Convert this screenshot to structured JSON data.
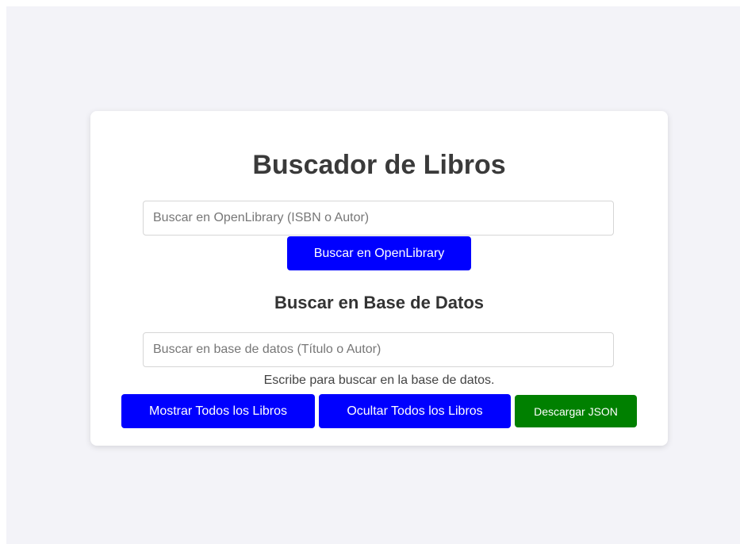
{
  "main": {
    "title": "Buscador de Libros",
    "openlibrary_search": {
      "placeholder": "Buscar en OpenLibrary (ISBN o Autor)",
      "value": "",
      "button_label": "Buscar en OpenLibrary"
    },
    "database_section": {
      "heading": "Buscar en Base de Datos",
      "search_placeholder": "Buscar en base de datos (Título o Autor)",
      "value": "",
      "hint": "Escribe para buscar en la base de datos."
    },
    "actions": {
      "show_all_label": "Mostrar Todos los Libros",
      "hide_all_label": "Ocultar Todos los Libros",
      "download_json_label": "Descargar JSON"
    }
  },
  "colors": {
    "page_background": "#f3f3f8",
    "card_background": "#ffffff",
    "primary_button": "#0000ff",
    "download_button": "#008000",
    "title_text": "#3a3a3a"
  }
}
